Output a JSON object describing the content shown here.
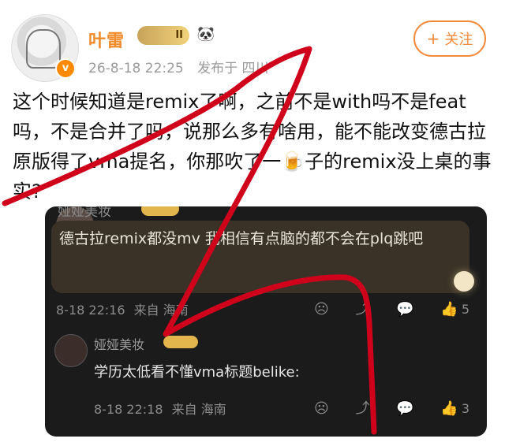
{
  "header": {
    "username": "叶雷",
    "level": "II",
    "panda": "🐼",
    "verified_badge": "v",
    "date": "26-8-18 22:25",
    "location": "发布于 四川",
    "follow_label": "关注"
  },
  "post": {
    "text": "这个时候知道是remix了啊，之前不是with吗不是feat吗，不是合并了吗，说那么多有啥用，能不能改变德古拉原版得了vma提名，你那吹了一🍺子的remix没上桌的事实?"
  },
  "comments": [
    {
      "name": "娅娅美妆",
      "text": "德古拉remix都没mv 我相信有点脑的都不会在plq跳吧",
      "time": "8-18 22:16",
      "from": "来自 海南",
      "likes": "5"
    },
    {
      "name": "娅娅美妆",
      "text": "学历太低看不懂vma标题belike:",
      "time": "8-18 22:18",
      "from": "来自 海南",
      "likes": "3"
    }
  ],
  "icons": {
    "emoji": "☹",
    "repost": "⤴",
    "comment": "💬",
    "like": "👍"
  },
  "colors": {
    "accent": "#f28a3c",
    "red_stroke": "#d0021b",
    "panel": "#1b1b1b"
  }
}
